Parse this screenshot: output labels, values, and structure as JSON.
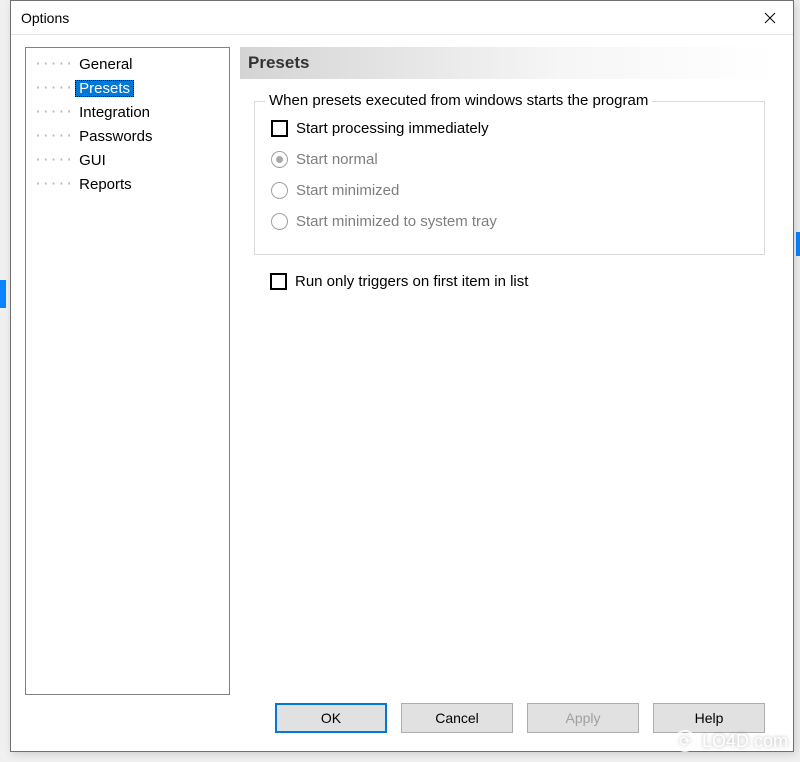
{
  "window": {
    "title": "Options"
  },
  "tree": {
    "items": [
      {
        "label": "General",
        "selected": false
      },
      {
        "label": "Presets",
        "selected": true
      },
      {
        "label": "Integration",
        "selected": false
      },
      {
        "label": "Passwords",
        "selected": false
      },
      {
        "label": "GUI",
        "selected": false
      },
      {
        "label": "Reports",
        "selected": false
      }
    ]
  },
  "panel": {
    "heading": "Presets",
    "group_legend": "When presets executed from windows starts the program",
    "check_start_processing": "Start processing immediately",
    "radio_normal": "Start normal",
    "radio_minimized": "Start minimized",
    "radio_tray": "Start minimized to system tray",
    "check_run_only_triggers": "Run only triggers on first item in list"
  },
  "buttons": {
    "ok": "OK",
    "cancel": "Cancel",
    "apply": "Apply",
    "help": "Help"
  },
  "watermark": "LO4D.com"
}
